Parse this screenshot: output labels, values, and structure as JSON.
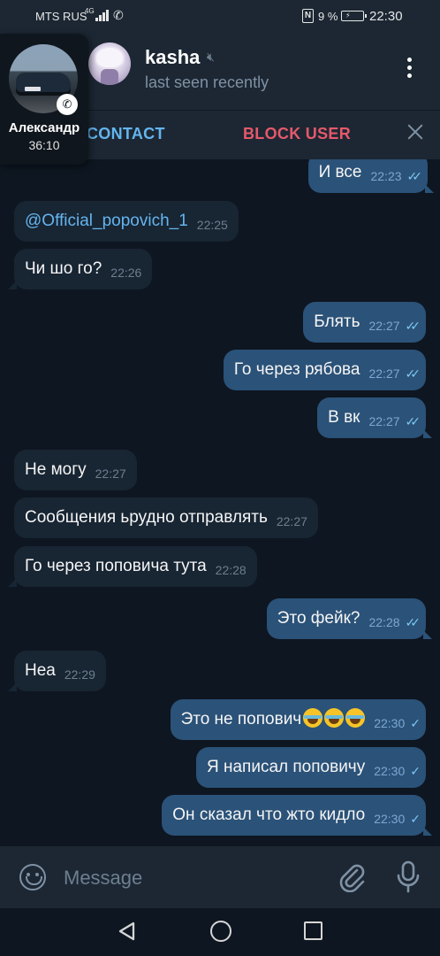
{
  "status_bar": {
    "carrier": "MTS RUS",
    "network": "4G",
    "battery_pct": "9 %",
    "time": "22:30"
  },
  "header": {
    "name": "kasha",
    "status": "last seen recently"
  },
  "action_bar": {
    "add_contact": "CONTACT",
    "block_user": "BLOCK USER"
  },
  "call_bubble": {
    "caller": "Александр",
    "duration": "36:10"
  },
  "messages": [
    {
      "dir": "out",
      "text": "И все",
      "time": "22:23",
      "read": true
    },
    {
      "dir": "in",
      "text": "@Official_popovich_1",
      "time": "22:25"
    },
    {
      "dir": "in",
      "text": "Чи шо го?",
      "time": "22:26"
    },
    {
      "dir": "out",
      "text": "Блять",
      "time": "22:27",
      "read": true
    },
    {
      "dir": "out",
      "text": "Го через рябова",
      "time": "22:27",
      "read": true
    },
    {
      "dir": "out",
      "text": "В вк",
      "time": "22:27",
      "read": true
    },
    {
      "dir": "in",
      "text": "Не могу",
      "time": "22:27"
    },
    {
      "dir": "in",
      "text": "Сообщения ьрудно отправлять",
      "time": "22:27"
    },
    {
      "dir": "in",
      "text": "Го через поповича тута",
      "time": "22:28"
    },
    {
      "dir": "out",
      "text": "Это фейк?",
      "time": "22:28",
      "read": true
    },
    {
      "dir": "in",
      "text": "Неа",
      "time": "22:29"
    },
    {
      "dir": "out",
      "text": "Это не попович",
      "time": "22:30",
      "read": false
    },
    {
      "dir": "out",
      "text": "Я написал поповичу",
      "time": "22:30",
      "read": false
    },
    {
      "dir": "out",
      "text": "Он сказал что жто кидло",
      "time": "22:30",
      "read": false
    }
  ],
  "composer": {
    "placeholder": "Message"
  },
  "icons": {
    "mute": "muted-speaker-icon",
    "menu": "more-vertical-icon",
    "close": "close-icon",
    "emoji": "emoji-icon",
    "attach": "paperclip-icon",
    "mic": "microphone-icon",
    "read": "double-check-icon",
    "sent": "single-check-icon",
    "laugh": "tears-of-joy-emoji"
  },
  "colors": {
    "background": "#0e1621",
    "header": "#1c2733",
    "incoming_bubble": "#182533",
    "outgoing_bubble": "#2b5278",
    "accent": "#64b5ef",
    "danger": "#e5596b"
  }
}
